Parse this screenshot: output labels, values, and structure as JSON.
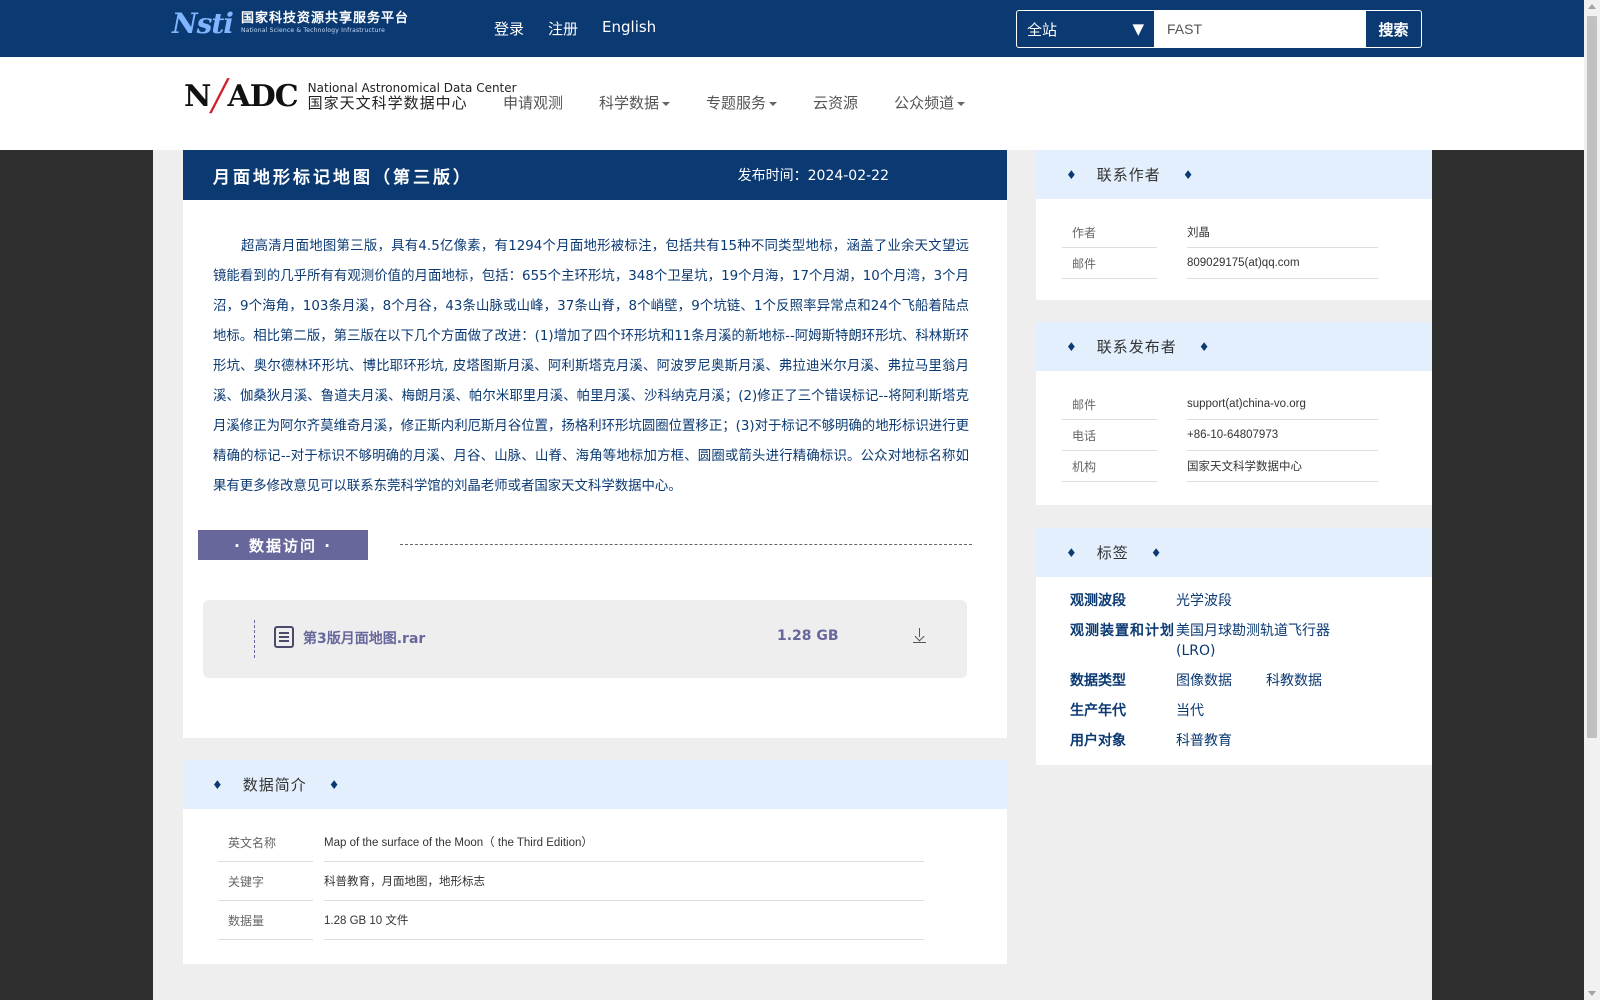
{
  "topbar": {
    "logo_mark": "Nsti",
    "logo_cn": "国家科技资源共享服务平台",
    "logo_en": "National Science & Technology Infrastructure",
    "links": [
      "登录",
      "注册",
      "English"
    ],
    "search": {
      "scope": "全站",
      "value": "FAST",
      "button": "搜索"
    }
  },
  "navbar": {
    "logo_mark_left": "N",
    "logo_mark_right": "ADC",
    "logo_en": "National Astronomical Data Center",
    "logo_cn": "国家天文科学数据中心",
    "items": [
      {
        "label": "申请观测",
        "dropdown": false
      },
      {
        "label": "科学数据",
        "dropdown": true
      },
      {
        "label": "专题服务",
        "dropdown": true
      },
      {
        "label": "云资源",
        "dropdown": false
      },
      {
        "label": "公众频道",
        "dropdown": true
      }
    ]
  },
  "dataset": {
    "title": "月面地形标记地图（第三版）",
    "date": "发布时间：2024-02-22",
    "description": "超高清月面地图第三版，具有4.5亿像素，有1294个月面地形被标注，包括共有15种不同类型地标，涵盖了业余天文望远镜能看到的几乎所有有观测价值的月面地标，包括：655个主环形坑，348个卫星坑，19个月海，17个月湖，10个月湾，3个月沼，9个海角，103条月溪，8个月谷，43条山脉或山峰，37条山脊，8个峭壁，9个坑链、1个反照率异常点和24个飞船着陆点地标。相比第二版，第三版在以下几个方面做了改进：(1)增加了四个环形坑和11条月溪的新地标--阿姆斯特朗环形坑、科林斯环形坑、奥尔德林环形坑、博比耶环形坑, 皮塔图斯月溪、阿利斯塔克月溪、阿波罗尼奥斯月溪、弗拉迪米尔月溪、弗拉马里翁月溪、伽桑狄月溪、鲁道夫月溪、梅朗月溪、帕尔米耶里月溪、帕里月溪、沙科纳克月溪；(2)修正了三个错误标记--将阿利斯塔克月溪修正为阿尔齐莫维奇月溪，修正斯内利厄斯月谷位置，扬格利环形坑圆圈位置移正；(3)对于标记不够明确的地形标识进行更精确的标记--对于标识不够明确的月溪、月谷、山脉、山脊、海角等地标加方框、圆圈或箭头进行精确标识。公众对地标名称如果有更多修改意见可以联系东莞科学馆的刘晶老师或者国家天文科学数据中心。"
  },
  "access": {
    "label": "· 数据访问 ·",
    "file": {
      "name": "第3版月面地图.rar",
      "size": "1.28 GB"
    }
  },
  "intro": {
    "heading": "数据简介",
    "rows": [
      {
        "key": "英文名称",
        "value": "Map of the surface of the Moon（ the Third Edition）"
      },
      {
        "key": "关键字",
        "value": "科普教育，月面地图，地形标志"
      },
      {
        "key": "数据量",
        "value": "1.28 GB 10 文件"
      }
    ]
  },
  "contact_author": {
    "heading": "联系作者",
    "rows": [
      {
        "key": "作者",
        "value": "刘晶"
      },
      {
        "key": "邮件",
        "value": "809029175(at)qq.com"
      }
    ]
  },
  "contact_publisher": {
    "heading": "联系发布者",
    "rows": [
      {
        "key": "邮件",
        "value": "support(at)china-vo.org"
      },
      {
        "key": "电话",
        "value": "+86-10-64807973"
      },
      {
        "key": "机构",
        "value": "国家天文科学数据中心"
      }
    ]
  },
  "tags": {
    "heading": "标签",
    "rows": [
      {
        "key": "观测波段",
        "values": [
          "光学波段"
        ]
      },
      {
        "key": "观测装置和计划",
        "values": [
          "美国月球勘测轨道飞行器(LRO)"
        ]
      },
      {
        "key": "数据类型",
        "values": [
          "图像数据",
          "科教数据"
        ]
      },
      {
        "key": "生产年代",
        "values": [
          "当代"
        ]
      },
      {
        "key": "用户对象",
        "values": [
          "科普教育"
        ]
      }
    ]
  },
  "colors": {
    "primary": "#0b3a73",
    "accent": "#67679b",
    "panel_head": "#e3effc",
    "logo_red": "#d21f2b"
  },
  "icons": [
    "dropdown-caret-icon",
    "file-icon",
    "download-icon",
    "diamond-icon"
  ]
}
